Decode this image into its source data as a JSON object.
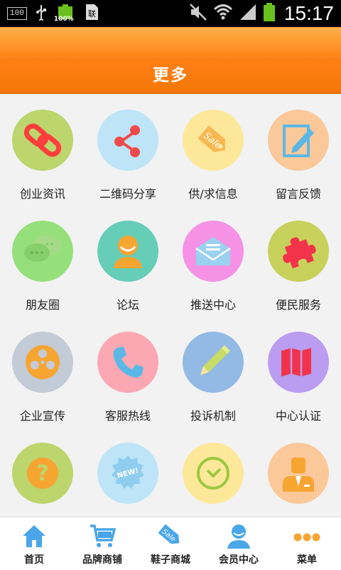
{
  "status_bar": {
    "battery_badge": "100",
    "battery_percent_label": "100%",
    "time": "15:17"
  },
  "header": {
    "title": "更多"
  },
  "grid_items": [
    {
      "label": "创业资讯",
      "icon": "link-icon",
      "color": "#bcd56d"
    },
    {
      "label": "二维码分享",
      "icon": "share-icon",
      "color": "#bde5f7"
    },
    {
      "label": "供/求信息",
      "icon": "sale-tag-icon",
      "color": "#fde89a"
    },
    {
      "label": "留言反馈",
      "icon": "edit-note-icon",
      "color": "#fbc899"
    },
    {
      "label": "朋友圈",
      "icon": "chat-bubbles-icon",
      "color": "#95e07b"
    },
    {
      "label": "论坛",
      "icon": "user-headset-icon",
      "color": "#66cdb7"
    },
    {
      "label": "推送中心",
      "icon": "envelope-icon",
      "color": "#f592e6"
    },
    {
      "label": "便民服务",
      "icon": "puzzle-icon",
      "color": "#c7d15c"
    },
    {
      "label": "企业宣传",
      "icon": "film-reel-icon",
      "color": "#c3cbd7"
    },
    {
      "label": "客服热线",
      "icon": "phone-icon",
      "color": "#fba8b3"
    },
    {
      "label": "投诉机制",
      "icon": "pencil-icon",
      "color": "#93b9e5"
    },
    {
      "label": "中心认证",
      "icon": "map-icon",
      "color": "#ba9cf0"
    },
    {
      "label": "",
      "icon": "question-icon",
      "color": "#bcd56d"
    },
    {
      "label": "",
      "icon": "new-badge-icon",
      "color": "#bde5f7"
    },
    {
      "label": "",
      "icon": "clock-icon",
      "color": "#fde89a"
    },
    {
      "label": "",
      "icon": "businessman-icon",
      "color": "#fbc899"
    }
  ],
  "bottom_nav": [
    {
      "label": "首页",
      "icon": "home-icon"
    },
    {
      "label": "品牌商铺",
      "icon": "cart-icon"
    },
    {
      "label": "鞋子商城",
      "icon": "sale-tag-icon"
    },
    {
      "label": "会员中心",
      "icon": "member-icon"
    },
    {
      "label": "菜单",
      "icon": "menu-dots-icon"
    }
  ],
  "colors": {
    "header_orange": "#ff7f14",
    "nav_icon_blue": "#4aa6e8"
  }
}
